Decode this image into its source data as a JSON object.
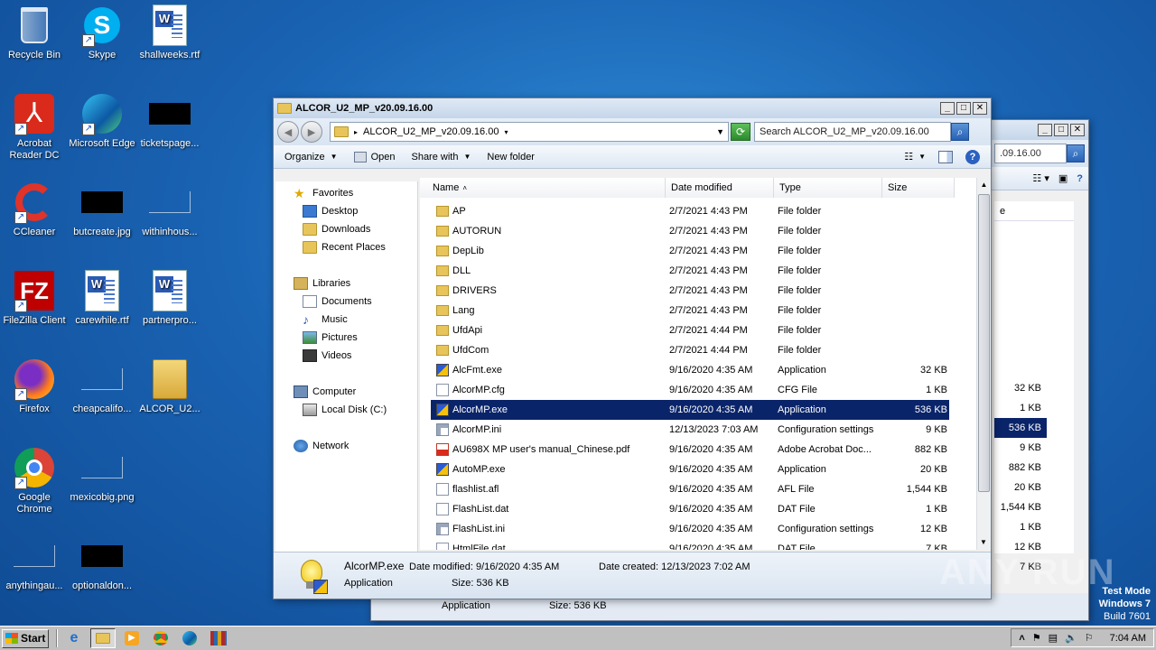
{
  "desktop": {
    "icons": [
      {
        "label": "Recycle Bin",
        "icon": "recycle-bin-icon"
      },
      {
        "label": "Skype",
        "icon": "skype-icon"
      },
      {
        "label": "shallweeks.rtf",
        "icon": "word-document-icon"
      },
      {
        "label": "Acrobat Reader DC",
        "icon": "acrobat-icon"
      },
      {
        "label": "Microsoft Edge",
        "icon": "edge-icon"
      },
      {
        "label": "ticketspage...",
        "icon": "redacted-thumbnail"
      },
      {
        "label": "CCleaner",
        "icon": "ccleaner-icon"
      },
      {
        "label": "butcreate.jpg",
        "icon": "redacted-thumbnail"
      },
      {
        "label": "withinhous...",
        "icon": "blank-file-icon"
      },
      {
        "label": "FileZilla Client",
        "icon": "filezilla-icon"
      },
      {
        "label": "carewhile.rtf",
        "icon": "word-document-icon"
      },
      {
        "label": "partnerpro...",
        "icon": "word-document-icon"
      },
      {
        "label": "Firefox",
        "icon": "firefox-icon"
      },
      {
        "label": "cheapcalifo...",
        "icon": "blank-file-icon"
      },
      {
        "label": "ALCOR_U2...",
        "icon": "folder-icon"
      },
      {
        "label": "Google Chrome",
        "icon": "chrome-icon"
      },
      {
        "label": "mexicobig.png",
        "icon": "blank-file-icon"
      },
      {
        "label": "anythingau...",
        "icon": "blank-file-icon"
      },
      {
        "label": "optionaldon...",
        "icon": "redacted-thumbnail"
      }
    ]
  },
  "back_window": {
    "search_fragment": ".09.16.00",
    "col_fragment": "e",
    "sizes": [
      "32 KB",
      "1 KB",
      "536 KB",
      "9 KB",
      "882 KB",
      "20 KB",
      "1,544 KB",
      "1 KB",
      "12 KB",
      "7 KB"
    ],
    "status_type": "Application",
    "status_size": "Size: 536 KB"
  },
  "window": {
    "title": "ALCOR_U2_MP_v20.09.16.00",
    "address": "ALCOR_U2_MP_v20.09.16.00",
    "search_placeholder": "Search ALCOR_U2_MP_v20.09.16.00",
    "toolbar": {
      "organize": "Organize",
      "open": "Open",
      "share_with": "Share with",
      "new_folder": "New folder"
    },
    "nav": {
      "favorites": "Favorites",
      "desktop": "Desktop",
      "downloads": "Downloads",
      "recent_places": "Recent Places",
      "libraries": "Libraries",
      "documents": "Documents",
      "music": "Music",
      "pictures": "Pictures",
      "videos": "Videos",
      "computer": "Computer",
      "local_disk": "Local Disk (C:)",
      "network": "Network"
    },
    "columns": {
      "name": "Name",
      "date": "Date modified",
      "type": "Type",
      "size": "Size"
    },
    "files": [
      {
        "name": "AP",
        "date": "2/7/2021 4:43 PM",
        "type": "File folder",
        "size": "",
        "kind": "folder"
      },
      {
        "name": "AUTORUN",
        "date": "2/7/2021 4:43 PM",
        "type": "File folder",
        "size": "",
        "kind": "folder"
      },
      {
        "name": "DepLib",
        "date": "2/7/2021 4:43 PM",
        "type": "File folder",
        "size": "",
        "kind": "folder"
      },
      {
        "name": "DLL",
        "date": "2/7/2021 4:43 PM",
        "type": "File folder",
        "size": "",
        "kind": "folder"
      },
      {
        "name": "DRIVERS",
        "date": "2/7/2021 4:43 PM",
        "type": "File folder",
        "size": "",
        "kind": "folder"
      },
      {
        "name": "Lang",
        "date": "2/7/2021 4:43 PM",
        "type": "File folder",
        "size": "",
        "kind": "folder"
      },
      {
        "name": "UfdApi",
        "date": "2/7/2021 4:44 PM",
        "type": "File folder",
        "size": "",
        "kind": "folder"
      },
      {
        "name": "UfdCom",
        "date": "2/7/2021 4:44 PM",
        "type": "File folder",
        "size": "",
        "kind": "folder"
      },
      {
        "name": "AlcFmt.exe",
        "date": "9/16/2020 4:35 AM",
        "type": "Application",
        "size": "32 KB",
        "kind": "exe"
      },
      {
        "name": "AlcorMP.cfg",
        "date": "9/16/2020 4:35 AM",
        "type": "CFG File",
        "size": "1 KB",
        "kind": "file"
      },
      {
        "name": "AlcorMP.exe",
        "date": "9/16/2020 4:35 AM",
        "type": "Application",
        "size": "536 KB",
        "kind": "exe",
        "selected": true
      },
      {
        "name": "AlcorMP.ini",
        "date": "12/13/2023 7:03 AM",
        "type": "Configuration settings",
        "size": "9 KB",
        "kind": "ini"
      },
      {
        "name": "AU698X MP user's manual_Chinese.pdf",
        "date": "9/16/2020 4:35 AM",
        "type": "Adobe Acrobat Doc...",
        "size": "882 KB",
        "kind": "pdf"
      },
      {
        "name": "AutoMP.exe",
        "date": "9/16/2020 4:35 AM",
        "type": "Application",
        "size": "20 KB",
        "kind": "exe"
      },
      {
        "name": "flashlist.afl",
        "date": "9/16/2020 4:35 AM",
        "type": "AFL File",
        "size": "1,544 KB",
        "kind": "file"
      },
      {
        "name": "FlashList.dat",
        "date": "9/16/2020 4:35 AM",
        "type": "DAT File",
        "size": "1 KB",
        "kind": "file"
      },
      {
        "name": "FlashList.ini",
        "date": "9/16/2020 4:35 AM",
        "type": "Configuration settings",
        "size": "12 KB",
        "kind": "ini"
      },
      {
        "name": "HtmlFile.dat",
        "date": "9/16/2020 4:35 AM",
        "type": "DAT File",
        "size": "7 KB",
        "kind": "file"
      }
    ],
    "status": {
      "filename": "AlcorMP.exe",
      "date_modified": "Date modified: 9/16/2020 4:35 AM",
      "date_created": "Date created: 12/13/2023 7:02 AM",
      "type": "Application",
      "size": "Size: 536 KB"
    }
  },
  "taskbar": {
    "start_label": "Start",
    "clock": "7:04 AM"
  },
  "watermark": {
    "text": "ANY RUN",
    "mode_line1": "Test Mode",
    "mode_line2": "Windows 7",
    "mode_line3": "Build 7601"
  },
  "colors": {
    "selection": "#0a246a",
    "desktop_blue": "#1a64b4"
  }
}
